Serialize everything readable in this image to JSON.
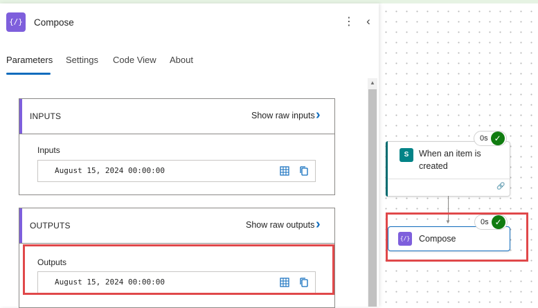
{
  "panel": {
    "title": "Compose",
    "op_icon_glyph": "{/}",
    "more_glyph": "⋮",
    "collapse_glyph": "‹",
    "tabs": [
      {
        "label": "Parameters",
        "active": true
      },
      {
        "label": "Settings",
        "active": false
      },
      {
        "label": "Code View",
        "active": false
      },
      {
        "label": "About",
        "active": false
      }
    ]
  },
  "inputs_card": {
    "header": "INPUTS",
    "raw_link": "Show raw inputs",
    "field_label": "Inputs",
    "field_value": "August 15, 2024 00:00:00"
  },
  "outputs_card": {
    "header": "OUTPUTS",
    "raw_link": "Show raw outputs",
    "field_label": "Outputs",
    "field_value": "August 15, 2024 00:00:00"
  },
  "canvas": {
    "trigger": {
      "title": "When an item is created",
      "duration": "0s",
      "icon_text": "S",
      "status": "succeeded"
    },
    "action": {
      "title": "Compose",
      "duration": "0s",
      "icon_glyph": "{/}",
      "status": "succeeded"
    }
  },
  "colors": {
    "accent": "#7e5fdc",
    "link": "#0f6cbd",
    "success": "#107c10",
    "highlight": "#e0484a",
    "sharepoint": "#038387"
  },
  "icons": [
    "operation-icon",
    "more-icon",
    "collapse-icon",
    "chevron-right-icon",
    "grid-icon",
    "copy-icon",
    "sharepoint-icon",
    "link-icon",
    "check-icon"
  ]
}
